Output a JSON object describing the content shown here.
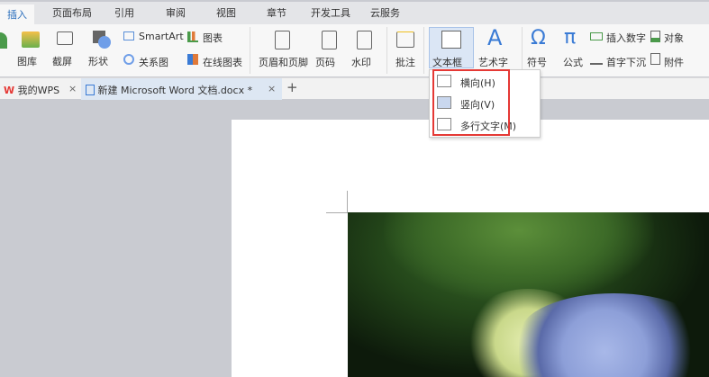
{
  "menu_tabs": [
    "插入",
    "页面布局",
    "引用",
    "审阅",
    "视图",
    "章节",
    "开发工具",
    "云服务"
  ],
  "ribbon": {
    "gallery": "图库",
    "screenshot": "截屏",
    "shapes": "形状",
    "smartart": "SmartArt",
    "chart": "图表",
    "relation": "关系图",
    "online_chart": "在线图表",
    "header_footer": "页眉和页脚",
    "page_number": "页码",
    "watermark": "水印",
    "comment": "批注",
    "textbox": "文本框",
    "wordart": "艺术字",
    "symbol": "符号",
    "formula": "公式",
    "insert_number": "插入数字",
    "object": "对象",
    "drop_cap": "首字下沉",
    "attachment": "附件"
  },
  "doc_tabs": {
    "home": "我的WPS",
    "doc": "新建 Microsoft Word 文档.docx *",
    "add": "+",
    "close": "×"
  },
  "textbox_menu": [
    {
      "label": "横向(H)"
    },
    {
      "label": "竖向(V)"
    },
    {
      "label": "多行文字(M)"
    }
  ],
  "colors": {
    "accent": "#2a6ebd",
    "highlight": "#e53935"
  }
}
